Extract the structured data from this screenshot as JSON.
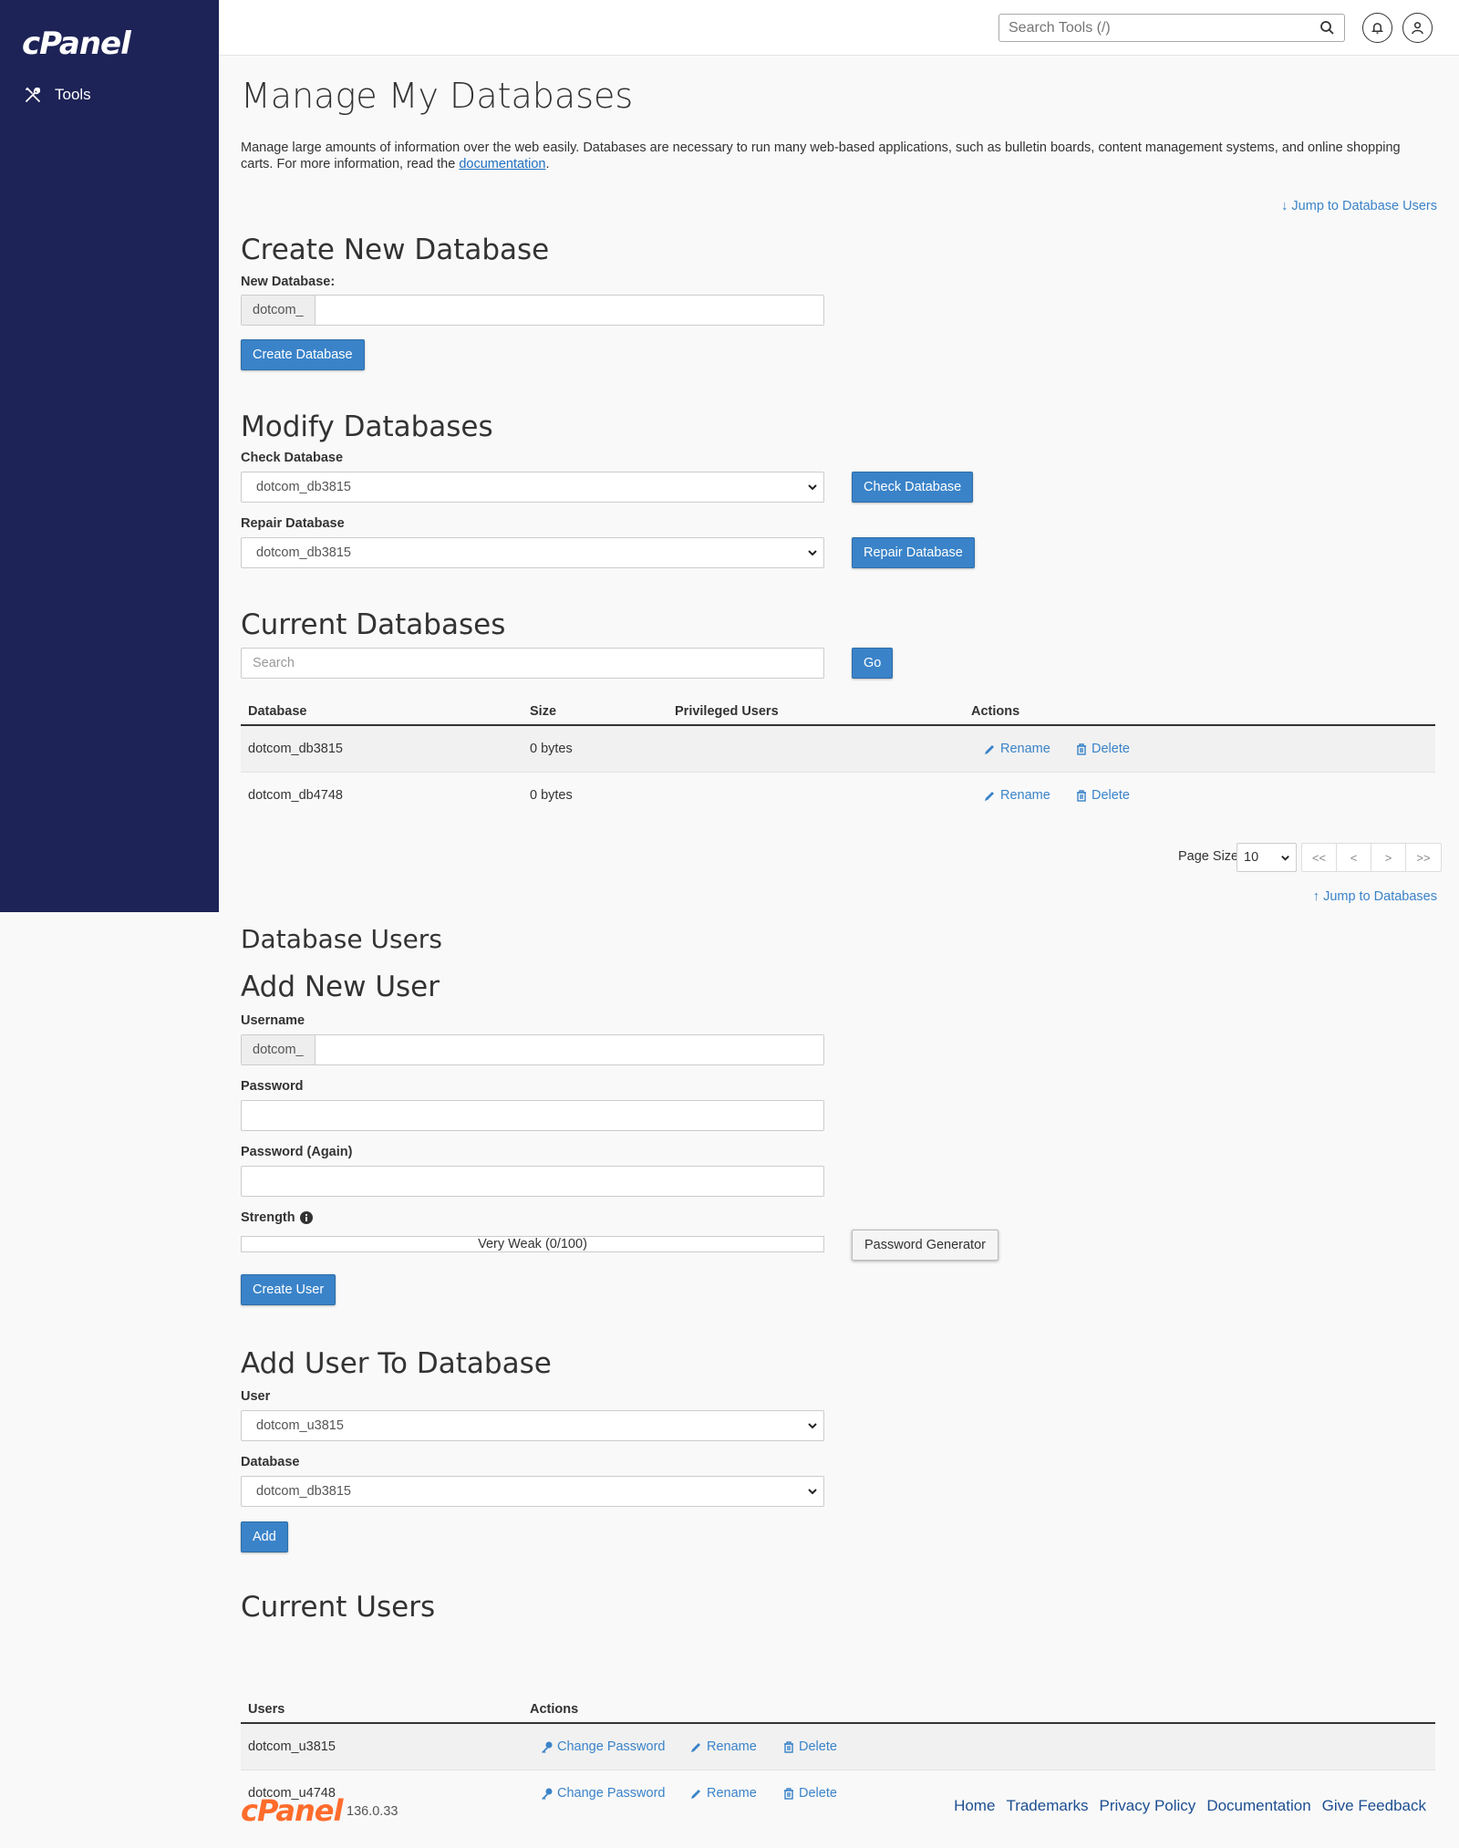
{
  "brand": {
    "logo": "cPanel",
    "version": "136.0.33"
  },
  "sidebar": {
    "items": [
      {
        "label": "Tools"
      }
    ]
  },
  "topbar": {
    "search_placeholder": "Search Tools (/)"
  },
  "page": {
    "title": "Manage My Databases",
    "description": "Manage large amounts of information over the web easily. Databases are necessary to run many web-based applications, such as bulletin boards, content management systems, and online shopping carts. For more information, read the ",
    "description_link": "documentation",
    "description_end": ".",
    "jump_users": "Jump to Database Users",
    "jump_databases": "Jump to Databases"
  },
  "create_db": {
    "heading": "Create New Database",
    "label": "New Database:",
    "prefix": "dotcom_",
    "button": "Create Database"
  },
  "modify_db": {
    "heading": "Modify Databases",
    "check_label": "Check Database",
    "check_value": "dotcom_db3815",
    "check_button": "Check Database",
    "repair_label": "Repair Database",
    "repair_value": "dotcom_db3815",
    "repair_button": "Repair Database"
  },
  "current_db": {
    "heading": "Current Databases",
    "search_placeholder": "Search",
    "go_button": "Go",
    "columns": [
      "Database",
      "Size",
      "Privileged Users",
      "Actions"
    ],
    "rows": [
      {
        "name": "dotcom_db3815",
        "size": "0 bytes",
        "users": "",
        "rename": "Rename",
        "delete": "Delete"
      },
      {
        "name": "dotcom_db4748",
        "size": "0 bytes",
        "users": "",
        "rename": "Rename",
        "delete": "Delete"
      }
    ],
    "page_size_label": "Page Size",
    "page_size": "10",
    "pager": [
      "<<",
      "<",
      ">",
      ">>"
    ]
  },
  "db_users": {
    "heading": "Database Users",
    "add_heading": "Add New User",
    "username_label": "Username",
    "prefix": "dotcom_",
    "password_label": "Password",
    "password_again_label": "Password (Again)",
    "strength_label": "Strength",
    "strength_value": "Very Weak (0/100)",
    "generator_button": "Password Generator",
    "create_button": "Create User"
  },
  "add_user_db": {
    "heading": "Add User To Database",
    "user_label": "User",
    "user_value": "dotcom_u3815",
    "db_label": "Database",
    "db_value": "dotcom_db3815",
    "add_button": "Add"
  },
  "current_users": {
    "heading": "Current Users",
    "columns": [
      "Users",
      "Actions"
    ],
    "rows": [
      {
        "name": "dotcom_u3815",
        "change_password": "Change Password",
        "rename": "Rename",
        "delete": "Delete"
      },
      {
        "name": "dotcom_u4748",
        "change_password": "Change Password",
        "rename": "Rename",
        "delete": "Delete"
      }
    ]
  },
  "footer": {
    "links": [
      "Home",
      "Trademarks",
      "Privacy Policy",
      "Documentation",
      "Give Feedback"
    ]
  },
  "colors": {
    "sidebar": "#1d2356",
    "primary": "#3a83c9",
    "brand_orange": "#ff6c2c"
  }
}
